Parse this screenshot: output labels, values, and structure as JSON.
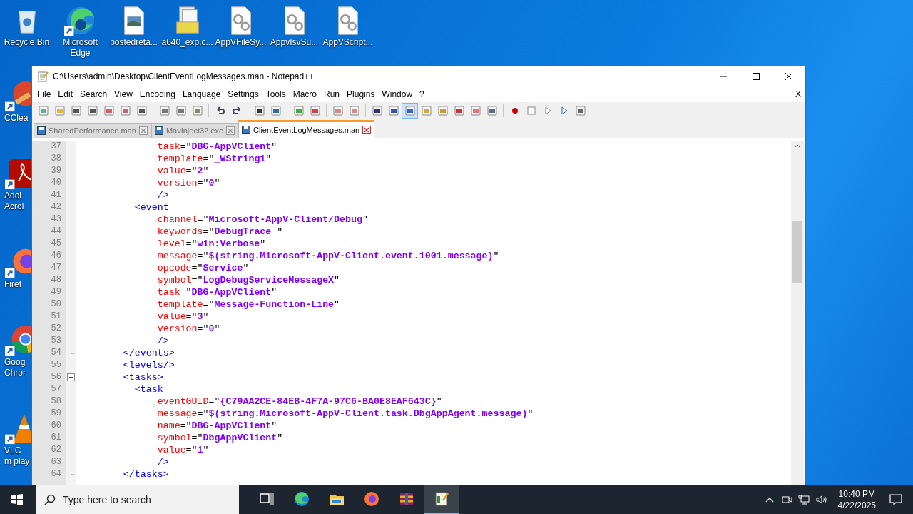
{
  "desktop_top_icons": [
    {
      "label": "Recycle Bin",
      "kind": "recycle",
      "shortcut": false
    },
    {
      "label": "Microsoft Edge",
      "kind": "edge",
      "shortcut": true
    },
    {
      "label": "postedreta...",
      "kind": "image",
      "shortcut": false
    },
    {
      "label": "a640_exp.c...",
      "kind": "archive",
      "shortcut": false
    },
    {
      "label": "AppVFileSy...",
      "kind": "gear",
      "shortcut": false
    },
    {
      "label": "AppvIsvSu...",
      "kind": "gear",
      "shortcut": false
    },
    {
      "label": "AppVScript...",
      "kind": "gear",
      "shortcut": false
    }
  ],
  "desktop_left_icons": [
    {
      "label": "CClea",
      "kind": "ccleaner",
      "shortcut": true
    },
    {
      "label": "Adol Acrol",
      "kind": "acrobat",
      "shortcut": true
    },
    {
      "label": "Firef",
      "kind": "firefox",
      "shortcut": true
    },
    {
      "label": "Goog Chror",
      "kind": "chrome",
      "shortcut": true
    },
    {
      "label": "VLC m play",
      "kind": "vlc",
      "shortcut": true
    }
  ],
  "window": {
    "title": "C:\\Users\\admin\\Desktop\\ClientEventLogMessages.man - Notepad++"
  },
  "menu": [
    "File",
    "Edit",
    "Search",
    "View",
    "Encoding",
    "Language",
    "Settings",
    "Tools",
    "Macro",
    "Run",
    "Plugins",
    "Window",
    "?"
  ],
  "menu_close": "X",
  "toolbar": [
    {
      "pressed": false
    },
    {
      "pressed": false
    },
    {
      "pressed": false
    },
    {
      "pressed": false
    },
    {
      "pressed": false
    },
    {
      "pressed": false
    },
    {
      "pressed": false
    },
    {
      "pressed": false
    },
    {
      "pressed": false
    },
    {
      "pressed": false
    },
    {
      "pressed": false
    },
    {
      "pressed": false
    },
    {
      "pressed": false
    },
    {
      "pressed": false
    },
    {
      "pressed": false
    },
    {
      "pressed": false
    },
    {
      "pressed": false
    },
    {
      "pressed": false
    },
    {
      "pressed": false
    },
    {
      "pressed": false
    },
    {
      "pressed": true
    },
    {
      "pressed": false
    },
    {
      "pressed": false
    },
    {
      "pressed": false
    },
    {
      "pressed": false
    },
    {
      "pressed": false
    },
    {
      "pressed": false
    },
    {
      "pressed": false
    },
    {
      "pressed": false
    },
    {
      "pressed": false
    },
    {
      "pressed": false
    }
  ],
  "tabs": [
    {
      "label": "SharedPerformance.man",
      "selected": false
    },
    {
      "label": "MavInject32.exe",
      "selected": false
    },
    {
      "label": "ClientEventLogMessages.man",
      "selected": true
    }
  ],
  "lines": [
    {
      "number": "37",
      "kind": "attr",
      "name": "              task",
      "value": "=\"DBG-AppVClient\""
    },
    {
      "number": "38",
      "kind": "attr",
      "name": "              template",
      "value": "=\"_WString1\""
    },
    {
      "number": "39",
      "kind": "attr",
      "name": "              value",
      "value": "=\"2\""
    },
    {
      "number": "40",
      "kind": "attr",
      "name": "              version",
      "value": "=\"0\""
    },
    {
      "number": "41",
      "kind": "tag",
      "text": "              />"
    },
    {
      "number": "42",
      "kind": "tag",
      "text": "          <event"
    },
    {
      "number": "43",
      "kind": "attr",
      "name": "              channel",
      "value": "=\"Microsoft-AppV-Client/Debug\""
    },
    {
      "number": "44",
      "kind": "attr",
      "name": "              keywords",
      "value": "=\"DebugTrace \""
    },
    {
      "number": "45",
      "kind": "attr",
      "name": "              level",
      "value": "=\"win:Verbose\""
    },
    {
      "number": "46",
      "kind": "attr",
      "name": "              message",
      "value": "=\"$(string.Microsoft-AppV-Client.event.1001.message)\""
    },
    {
      "number": "47",
      "kind": "attr",
      "name": "              opcode",
      "value": "=\"Service\""
    },
    {
      "number": "48",
      "kind": "attr",
      "name": "              symbol",
      "value": "=\"LogDebugServiceMessageX\""
    },
    {
      "number": "49",
      "kind": "attr",
      "name": "              task",
      "value": "=\"DBG-AppVClient\""
    },
    {
      "number": "50",
      "kind": "attr",
      "name": "              template",
      "value": "=\"Message-Function-Line\""
    },
    {
      "number": "51",
      "kind": "attr",
      "name": "              value",
      "value": "=\"3\""
    },
    {
      "number": "52",
      "kind": "attr",
      "name": "              version",
      "value": "=\"0\""
    },
    {
      "number": "53",
      "kind": "tag",
      "text": "              />"
    },
    {
      "number": "54",
      "kind": "tag",
      "text": "        </events>",
      "fold_start": false,
      "fold_end": true
    },
    {
      "number": "55",
      "kind": "tag",
      "text": "        <levels/>"
    },
    {
      "number": "56",
      "kind": "tag",
      "text": "        <tasks>",
      "fold_start": true,
      "fold_end": false
    },
    {
      "number": "57",
      "kind": "tag",
      "text": "          <task"
    },
    {
      "number": "58",
      "kind": "attr",
      "name": "              eventGUID",
      "value": "=\"{C79AA2CE-84EB-4F7A-97C6-BA0E8EAF643C}\""
    },
    {
      "number": "59",
      "kind": "attr",
      "name": "              message",
      "value": "=\"$(string.Microsoft-AppV-Client.task.DbgAppAgent.message)\""
    },
    {
      "number": "60",
      "kind": "attr",
      "name": "              name",
      "value": "=\"DBG-AppVClient\""
    },
    {
      "number": "61",
      "kind": "attr",
      "name": "              symbol",
      "value": "=\"DbgAppVClient\""
    },
    {
      "number": "62",
      "kind": "attr",
      "name": "              value",
      "value": "=\"1\""
    },
    {
      "number": "63",
      "kind": "tag",
      "text": "              />"
    },
    {
      "number": "64",
      "kind": "tag",
      "text": "        </tasks>",
      "fold_start": false,
      "fold_end": true
    }
  ],
  "taskbar": {
    "search": {
      "placeholder": "Type here to search"
    },
    "apps": [
      {
        "kind": "taskview",
        "active": false
      },
      {
        "kind": "edge",
        "active": false
      },
      {
        "kind": "explorer",
        "active": false
      },
      {
        "kind": "firefox",
        "active": false
      },
      {
        "kind": "winrar",
        "active": false
      },
      {
        "kind": "notepad",
        "active": true
      }
    ],
    "time": "10:40 PM",
    "date": "4/22/2025"
  }
}
